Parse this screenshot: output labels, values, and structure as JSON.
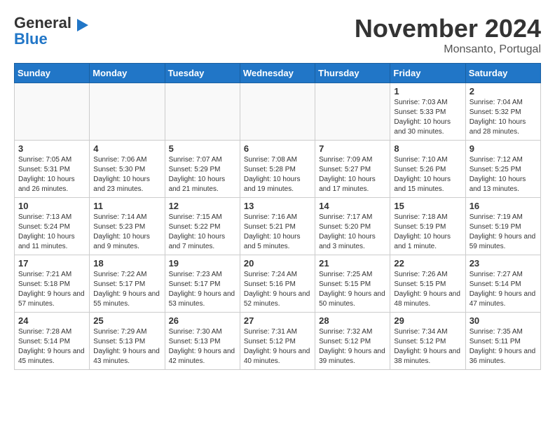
{
  "header": {
    "logo_line1": "General",
    "logo_line2": "Blue",
    "month": "November 2024",
    "location": "Monsanto, Portugal"
  },
  "days_of_week": [
    "Sunday",
    "Monday",
    "Tuesday",
    "Wednesday",
    "Thursday",
    "Friday",
    "Saturday"
  ],
  "weeks": [
    [
      {
        "day": "",
        "empty": true
      },
      {
        "day": "",
        "empty": true
      },
      {
        "day": "",
        "empty": true
      },
      {
        "day": "",
        "empty": true
      },
      {
        "day": "",
        "empty": true
      },
      {
        "day": "1",
        "sunrise": "7:03 AM",
        "sunset": "5:33 PM",
        "daylight": "10 hours and 30 minutes."
      },
      {
        "day": "2",
        "sunrise": "7:04 AM",
        "sunset": "5:32 PM",
        "daylight": "10 hours and 28 minutes."
      }
    ],
    [
      {
        "day": "3",
        "sunrise": "7:05 AM",
        "sunset": "5:31 PM",
        "daylight": "10 hours and 26 minutes."
      },
      {
        "day": "4",
        "sunrise": "7:06 AM",
        "sunset": "5:30 PM",
        "daylight": "10 hours and 23 minutes."
      },
      {
        "day": "5",
        "sunrise": "7:07 AM",
        "sunset": "5:29 PM",
        "daylight": "10 hours and 21 minutes."
      },
      {
        "day": "6",
        "sunrise": "7:08 AM",
        "sunset": "5:28 PM",
        "daylight": "10 hours and 19 minutes."
      },
      {
        "day": "7",
        "sunrise": "7:09 AM",
        "sunset": "5:27 PM",
        "daylight": "10 hours and 17 minutes."
      },
      {
        "day": "8",
        "sunrise": "7:10 AM",
        "sunset": "5:26 PM",
        "daylight": "10 hours and 15 minutes."
      },
      {
        "day": "9",
        "sunrise": "7:12 AM",
        "sunset": "5:25 PM",
        "daylight": "10 hours and 13 minutes."
      }
    ],
    [
      {
        "day": "10",
        "sunrise": "7:13 AM",
        "sunset": "5:24 PM",
        "daylight": "10 hours and 11 minutes."
      },
      {
        "day": "11",
        "sunrise": "7:14 AM",
        "sunset": "5:23 PM",
        "daylight": "10 hours and 9 minutes."
      },
      {
        "day": "12",
        "sunrise": "7:15 AM",
        "sunset": "5:22 PM",
        "daylight": "10 hours and 7 minutes."
      },
      {
        "day": "13",
        "sunrise": "7:16 AM",
        "sunset": "5:21 PM",
        "daylight": "10 hours and 5 minutes."
      },
      {
        "day": "14",
        "sunrise": "7:17 AM",
        "sunset": "5:20 PM",
        "daylight": "10 hours and 3 minutes."
      },
      {
        "day": "15",
        "sunrise": "7:18 AM",
        "sunset": "5:19 PM",
        "daylight": "10 hours and 1 minute."
      },
      {
        "day": "16",
        "sunrise": "7:19 AM",
        "sunset": "5:19 PM",
        "daylight": "9 hours and 59 minutes."
      }
    ],
    [
      {
        "day": "17",
        "sunrise": "7:21 AM",
        "sunset": "5:18 PM",
        "daylight": "9 hours and 57 minutes."
      },
      {
        "day": "18",
        "sunrise": "7:22 AM",
        "sunset": "5:17 PM",
        "daylight": "9 hours and 55 minutes."
      },
      {
        "day": "19",
        "sunrise": "7:23 AM",
        "sunset": "5:17 PM",
        "daylight": "9 hours and 53 minutes."
      },
      {
        "day": "20",
        "sunrise": "7:24 AM",
        "sunset": "5:16 PM",
        "daylight": "9 hours and 52 minutes."
      },
      {
        "day": "21",
        "sunrise": "7:25 AM",
        "sunset": "5:15 PM",
        "daylight": "9 hours and 50 minutes."
      },
      {
        "day": "22",
        "sunrise": "7:26 AM",
        "sunset": "5:15 PM",
        "daylight": "9 hours and 48 minutes."
      },
      {
        "day": "23",
        "sunrise": "7:27 AM",
        "sunset": "5:14 PM",
        "daylight": "9 hours and 47 minutes."
      }
    ],
    [
      {
        "day": "24",
        "sunrise": "7:28 AM",
        "sunset": "5:14 PM",
        "daylight": "9 hours and 45 minutes."
      },
      {
        "day": "25",
        "sunrise": "7:29 AM",
        "sunset": "5:13 PM",
        "daylight": "9 hours and 43 minutes."
      },
      {
        "day": "26",
        "sunrise": "7:30 AM",
        "sunset": "5:13 PM",
        "daylight": "9 hours and 42 minutes."
      },
      {
        "day": "27",
        "sunrise": "7:31 AM",
        "sunset": "5:12 PM",
        "daylight": "9 hours and 40 minutes."
      },
      {
        "day": "28",
        "sunrise": "7:32 AM",
        "sunset": "5:12 PM",
        "daylight": "9 hours and 39 minutes."
      },
      {
        "day": "29",
        "sunrise": "7:34 AM",
        "sunset": "5:12 PM",
        "daylight": "9 hours and 38 minutes."
      },
      {
        "day": "30",
        "sunrise": "7:35 AM",
        "sunset": "5:11 PM",
        "daylight": "9 hours and 36 minutes."
      }
    ]
  ]
}
